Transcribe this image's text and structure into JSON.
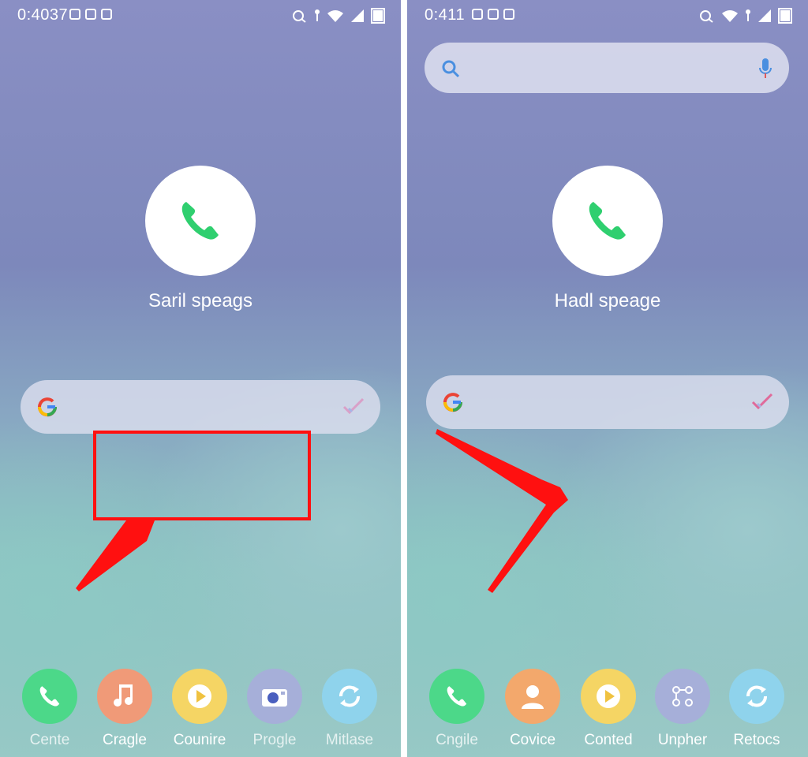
{
  "left_screen": {
    "status": {
      "time": "0:4037"
    },
    "call_label": "Saril speags",
    "dock": [
      {
        "label": "Cente",
        "icon": "phone-icon",
        "color": "#4cd889"
      },
      {
        "label": "Cragle",
        "icon": "music-note-icon",
        "color": "#f09a78"
      },
      {
        "label": "Counire",
        "icon": "play-icon",
        "color": "#f5d564"
      },
      {
        "label": "Progle",
        "icon": "camera-icon",
        "color": "#a6afd9"
      },
      {
        "label": "Mitlase",
        "icon": "sync-icon",
        "color": "#8fd3ec"
      }
    ]
  },
  "right_screen": {
    "status": {
      "time": "0:411"
    },
    "call_label": "Hadl speage",
    "dock": [
      {
        "label": "Cngile",
        "icon": "phone-icon",
        "color": "#4cd889"
      },
      {
        "label": "Covice",
        "icon": "contact-icon",
        "color": "#f3a86c"
      },
      {
        "label": "Conted",
        "icon": "play-icon",
        "color": "#f5d564"
      },
      {
        "label": "Unpher",
        "icon": "network-icon",
        "color": "#a6afd9"
      },
      {
        "label": "Retocs",
        "icon": "sync-icon",
        "color": "#8fd3ec"
      }
    ]
  },
  "colors": {
    "accent_red": "#ff1010",
    "call_green": "#2fcf6f",
    "search_blue": "#4a8fe0"
  }
}
